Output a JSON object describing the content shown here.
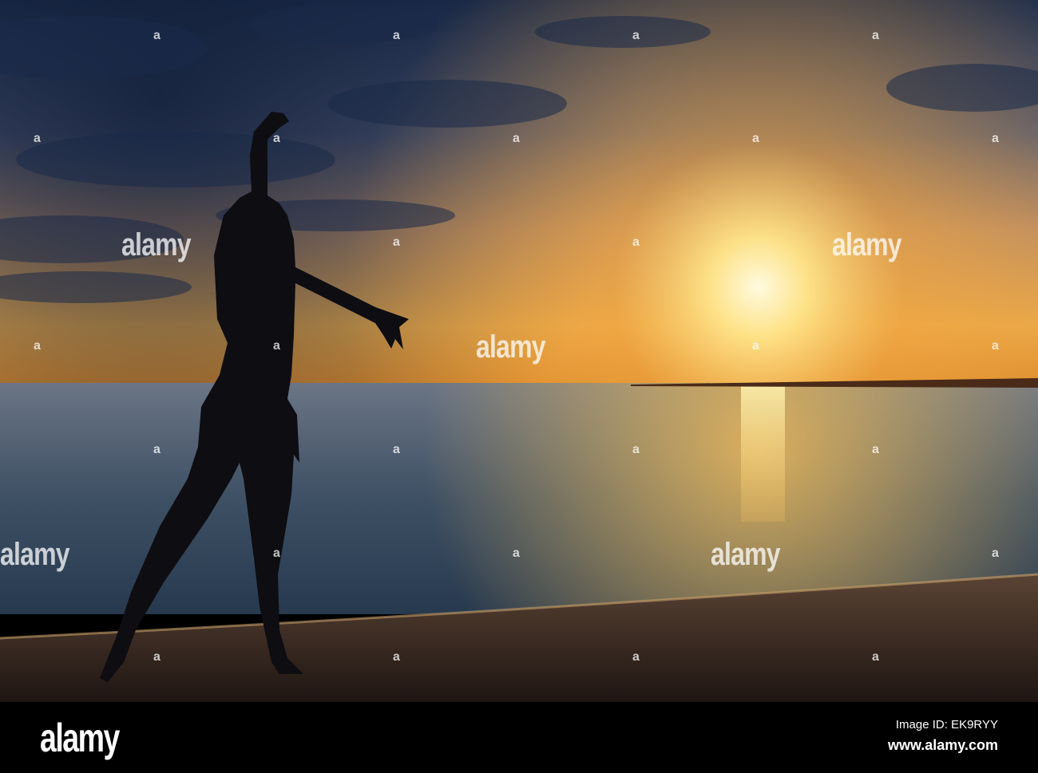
{
  "watermark": {
    "brand": "alamy",
    "mark": "a"
  },
  "footer": {
    "logo": "alamy",
    "image_id": "Image ID: EK9RYY",
    "website": "www.alamy.com"
  },
  "colors": {
    "sky_top": "#1c2c4a",
    "sun": "#fff6c8",
    "sea": "#3d4e63",
    "sand": "#3a2a22"
  }
}
